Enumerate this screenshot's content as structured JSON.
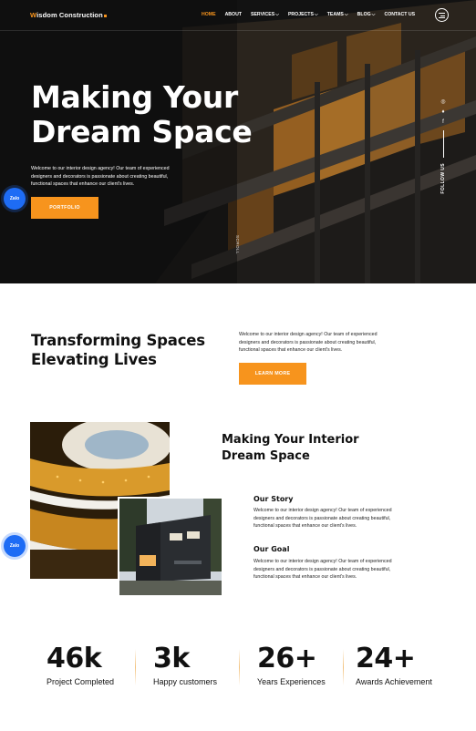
{
  "header": {
    "brand_first": "W",
    "brand_rest": "isdom Construction",
    "nav": [
      {
        "label": "HOME",
        "active": true,
        "dropdown": false
      },
      {
        "label": "ABOUT",
        "active": false,
        "dropdown": false
      },
      {
        "label": "SERVICES",
        "active": false,
        "dropdown": true
      },
      {
        "label": "PROJECTS",
        "active": false,
        "dropdown": true
      },
      {
        "label": "TEAMS",
        "active": false,
        "dropdown": true
      },
      {
        "label": "BLOG",
        "active": false,
        "dropdown": true
      },
      {
        "label": "CONTACT US",
        "active": false,
        "dropdown": false
      }
    ],
    "menu_icon": "hamburger-icon"
  },
  "hero": {
    "title_line1": "Making Your",
    "title_line2": "Dream Space",
    "text": "Welcome to our interior design agency! Our team of experienced designers and decorators is passionate about creating beautiful, functional spaces that enhance our client's lives.",
    "button": "PORTFOLIO",
    "follow_label": "FOLLOW US",
    "scroll_label": "SCROLL",
    "social_icons": [
      "instagram-icon",
      "twitter-icon",
      "facebook-icon"
    ]
  },
  "zalo_label": "Zalo",
  "intro": {
    "title_line1": "Transforming Spaces",
    "title_line2": "Elevating Lives",
    "text": "Welcome to our interior design agency! Our team of experienced designers and decorators is passionate about creating beautiful, functional spaces that enhance our client's lives.",
    "button": "LEARN MORE"
  },
  "about": {
    "title_line1": "Making Your Interior",
    "title_line2": "Dream Space",
    "story_title": "Our Story",
    "story_text": "Welcome to our interior design agency! Our team of experienced designers and decorators is passionate about creating beautiful, functional spaces that enhance our client's lives.",
    "goal_title": "Our Goal",
    "goal_text": "Welcome to our interior design agency! Our team of experienced designers and decorators is passionate about creating beautiful, functional spaces that enhance our client's lives."
  },
  "stats": [
    {
      "value": "46k",
      "label": "Project Completed"
    },
    {
      "value": "3k",
      "label": "Happy customers"
    },
    {
      "value": "26+",
      "label": "Years Experiences"
    },
    {
      "value": "24+",
      "label": "Awards Achievement"
    }
  ],
  "colors": {
    "accent": "#f7941d",
    "zalo": "#1e6cf5",
    "hero_bg": "#141414"
  }
}
